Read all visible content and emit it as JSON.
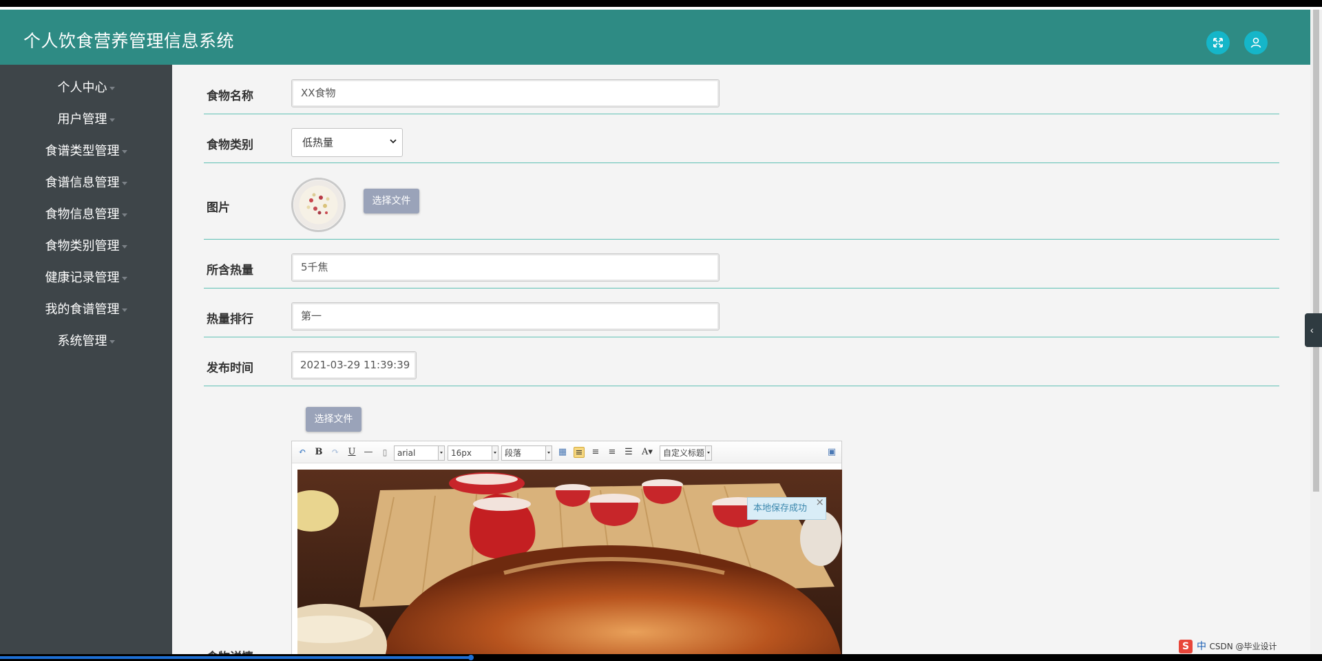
{
  "app": {
    "title": "个人饮食营养管理信息系统"
  },
  "header": {
    "fullscreen_icon": "expand-icon",
    "user_icon": "user-icon",
    "accent": "#2e8b84",
    "button_color": "#15b6c9"
  },
  "sidebar": {
    "items": [
      {
        "label": "个人中心"
      },
      {
        "label": "用户管理"
      },
      {
        "label": "食谱类型管理"
      },
      {
        "label": "食谱信息管理"
      },
      {
        "label": "食物信息管理"
      },
      {
        "label": "食物类别管理"
      },
      {
        "label": "健康记录管理"
      },
      {
        "label": "我的食谱管理"
      },
      {
        "label": "系统管理"
      }
    ]
  },
  "form": {
    "name_label": "食物名称",
    "name_value": "XX食物",
    "category_label": "食物类别",
    "category_value": "低热量",
    "image_label": "图片",
    "file_button": "选择文件",
    "calories_label": "所含热量",
    "calories_value": "5千焦",
    "rank_label": "热量排行",
    "rank_value": "第一",
    "publish_label": "发布时间",
    "publish_value": "2021-03-29 11:39:39",
    "editor_file_button": "选择文件",
    "details_label": "食物详情"
  },
  "editor": {
    "font_family": "arial",
    "font_size": "16px",
    "paragraph": "段落",
    "custom_title": "自定义标题",
    "toast": "本地保存成功",
    "toast_close": "×"
  },
  "taskbar": {
    "ime": "中",
    "watermark": "CSDN @毕业设计"
  }
}
